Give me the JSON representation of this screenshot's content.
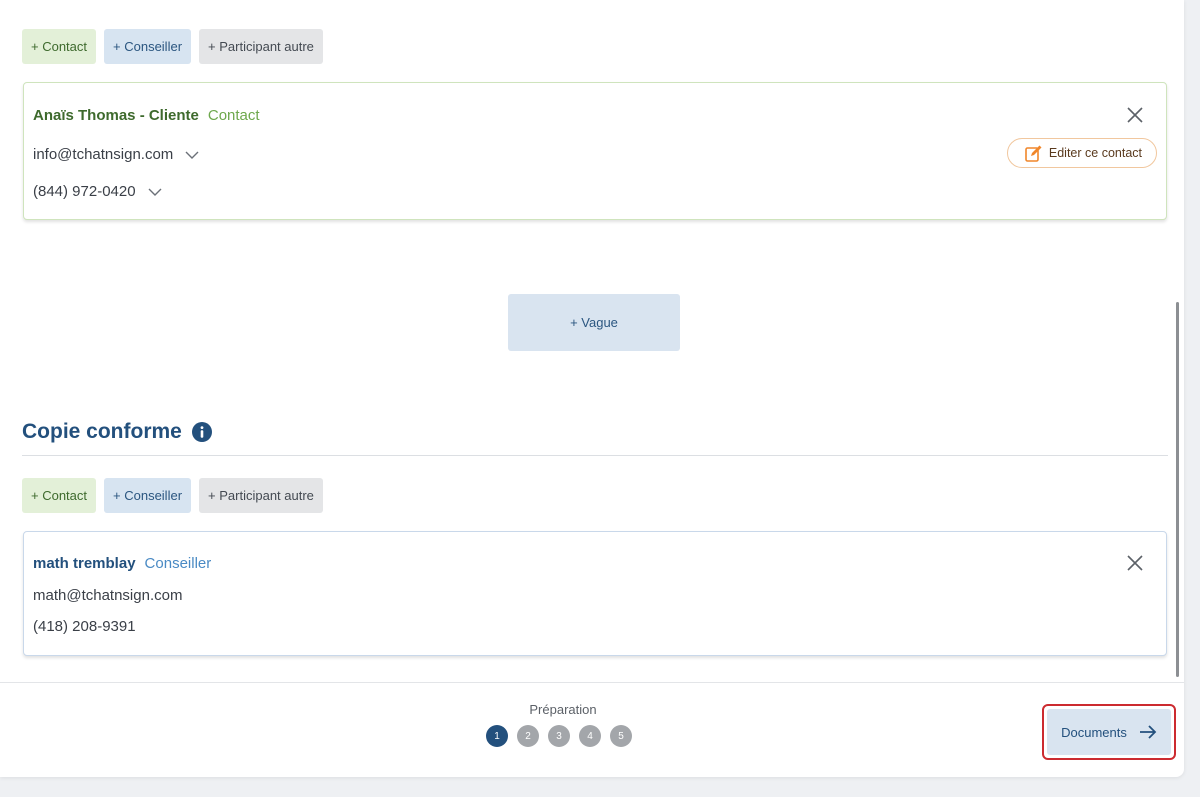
{
  "signers": {
    "add_buttons": {
      "contact": "+ Contact",
      "conseiller": "+ Conseiller",
      "autre": "+ Participant autre"
    },
    "card": {
      "name": "Anaïs Thomas - Cliente",
      "role": "Contact",
      "email": "info@tchatnsign.com",
      "phone": "(844) 972-0420",
      "edit_label": "Editer ce contact"
    },
    "vague_label": "+ Vague"
  },
  "cc": {
    "title": "Copie conforme",
    "add_buttons": {
      "contact": "+ Contact",
      "conseiller": "+ Conseiller",
      "autre": "+ Participant autre"
    },
    "card": {
      "name": "math tremblay",
      "role": "Conseiller",
      "email": "math@tchatnsign.com",
      "phone": "(418) 208-9391"
    }
  },
  "footer": {
    "step_label": "Préparation",
    "steps": [
      "1",
      "2",
      "3",
      "4",
      "5"
    ],
    "active_step": 1,
    "next_label": "Documents"
  },
  "colors": {
    "primary": "#23507d",
    "contact_green": "#3e6a2d",
    "edit_orange": "#f0862a",
    "highlight_red": "#cc2b30"
  }
}
